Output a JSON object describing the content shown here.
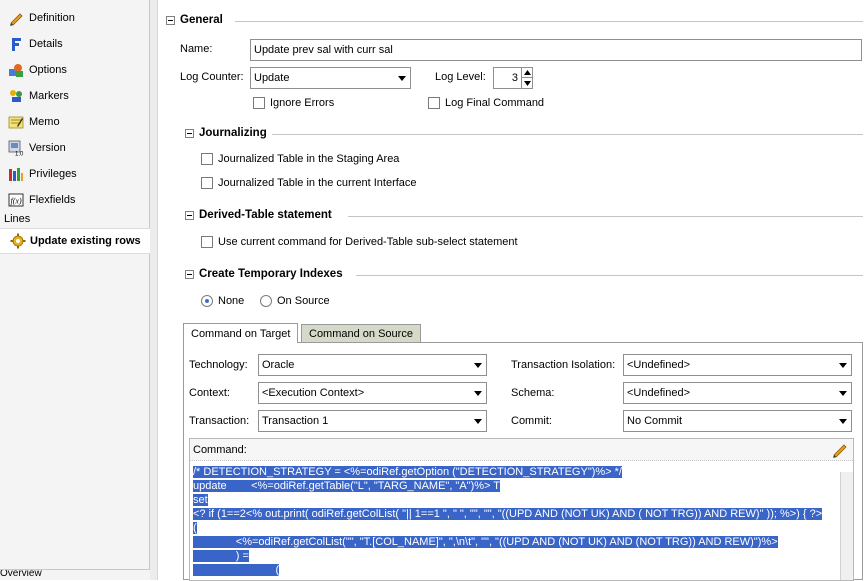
{
  "sidebar": {
    "items": [
      {
        "label": "Definition",
        "icon": "pencil-icon"
      },
      {
        "label": "Details",
        "icon": "details-icon"
      },
      {
        "label": "Options",
        "icon": "options-icon"
      },
      {
        "label": "Markers",
        "icon": "markers-icon"
      },
      {
        "label": "Memo",
        "icon": "memo-icon"
      },
      {
        "label": "Version",
        "icon": "version-icon"
      },
      {
        "label": "Privileges",
        "icon": "privileges-icon"
      },
      {
        "label": "Flexfields",
        "icon": "flexfields-icon"
      }
    ],
    "group_label": "Lines",
    "selected": {
      "label": "Update existing rows",
      "icon": "gear-icon"
    },
    "bottom_label": "Overview"
  },
  "general": {
    "title": "General",
    "name_label": "Name:",
    "name_value": "Update prev sal with curr sal",
    "log_counter_label": "Log Counter:",
    "log_counter_value": "Update",
    "log_level_label": "Log Level:",
    "log_level_value": "3",
    "ignore_errors": "Ignore Errors",
    "log_final_command": "Log Final Command"
  },
  "journalizing": {
    "title": "Journalizing",
    "opt1": "Journalized Table in the Staging Area",
    "opt2": "Journalized Table in the current Interface"
  },
  "derived": {
    "title": "Derived-Table statement",
    "opt1": "Use current command for Derived-Table sub-select statement"
  },
  "temp_indexes": {
    "title": "Create Temporary Indexes",
    "opt_none": "None",
    "opt_source": "On Source",
    "selected": "None"
  },
  "tabs": [
    "Command on Target",
    "Command on Source"
  ],
  "command": {
    "technology_label": "Technology:",
    "technology_value": "Oracle",
    "context_label": "Context:",
    "context_value": "<Execution Context>",
    "transaction_label": "Transaction:",
    "transaction_value": "Transaction 1",
    "isolation_label": "Transaction Isolation:",
    "isolation_value": "<Undefined>",
    "schema_label": "Schema:",
    "schema_value": "<Undefined>",
    "commit_label": "Commit:",
    "commit_value": "No Commit",
    "command_label": "Command:",
    "code_lines": [
      "/* DETECTION_STRATEGY = <%=odiRef.getOption (\"DETECTION_STRATEGY\")%> */",
      "update        <%=odiRef.getTable(\"L\", \"TARG_NAME\", \"A\")%> T",
      "set",
      "<? if (1==2<% out.print( odiRef.getColList( \"|| 1==1 \", \" \", \"\", \"\", \"((UPD AND (NOT UK) AND ( NOT TRG)) AND REW)\" )); %>) { ?>",
      "(",
      "              <%=odiRef.getColList(\"\", \"T.[COL_NAME]\", \",\\n\\t\", \"\", \"((UPD AND (NOT UK) AND (NOT TRG)) AND REW)\")%>",
      "              ) =",
      "                           ("
    ]
  }
}
